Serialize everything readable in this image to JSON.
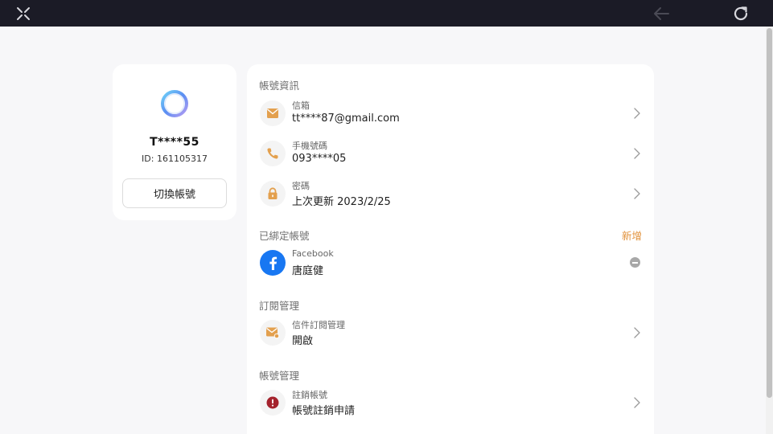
{
  "topbar": {
    "close_icon": "close-x-icon",
    "back_icon": "arrow-left-icon",
    "refresh_icon": "refresh-icon"
  },
  "profile": {
    "username": "T****55",
    "user_id": "ID: 161105317",
    "switch_label": "切換帳號"
  },
  "sections": {
    "account_info": "帳號資訊",
    "linked_accounts": "已綁定帳號",
    "add_label": "新增",
    "subscription": "訂閱管理",
    "account_management": "帳號管理"
  },
  "rows": {
    "email": {
      "label": "信箱",
      "value": "tt****87@gmail.com",
      "icon": "mail-icon"
    },
    "phone": {
      "label": "手機號碼",
      "value": "093****05",
      "icon": "phone-icon"
    },
    "password": {
      "label": "密碼",
      "value": "上次更新 2023/2/25",
      "icon": "lock-icon"
    },
    "facebook": {
      "label": "Facebook",
      "value": "唐庭健",
      "icon": "facebook-icon"
    },
    "mail_subscription": {
      "label": "信件訂閱管理",
      "value": "開啟",
      "icon": "mail-subscription-icon"
    },
    "deactivate": {
      "label": "註銷帳號",
      "value": "帳號註銷申請",
      "icon": "alert-icon"
    }
  },
  "colors": {
    "accent": "#e1913a",
    "topbar": "#1b1b26",
    "facebook": "#1877f2",
    "alert": "#a4222c"
  }
}
